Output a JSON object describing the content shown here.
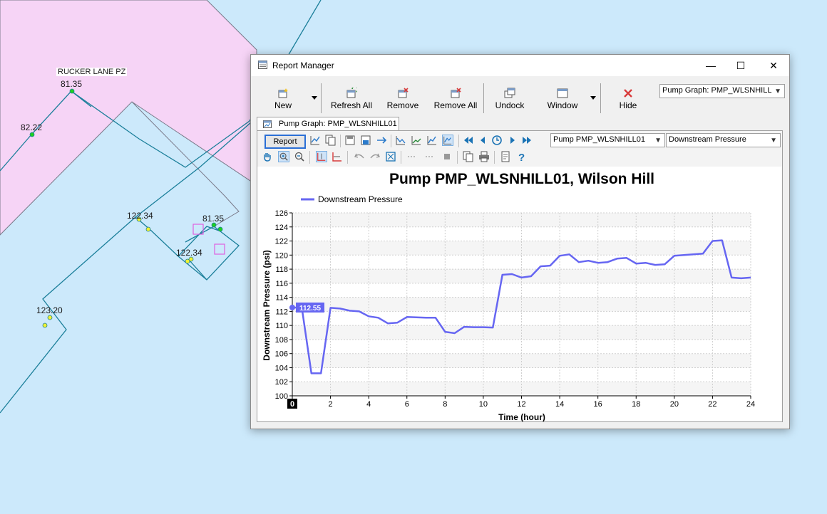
{
  "map": {
    "zone_label": "RUCKER LANE PZ",
    "node_labels": [
      "81.35",
      "82.22",
      "122.34",
      "81.35",
      "122.34",
      "123.20"
    ]
  },
  "window": {
    "title": "Report Manager",
    "controls": {
      "minimize": "—",
      "maximize": "☐",
      "close": "✕"
    }
  },
  "toolbar": {
    "new_label": "New",
    "refresh_all_label": "Refresh All",
    "remove_label": "Remove",
    "remove_all_label": "Remove All",
    "undock_label": "Undock",
    "window_label": "Window",
    "hide_label": "Hide",
    "report_select": "Pump Graph: PMP_WLSNHILL"
  },
  "tab": {
    "label": "Pump Graph: PMP_WLSNHILL01"
  },
  "report_toolbar": {
    "report_button": "Report",
    "element_select": "Pump PMP_WLSNHILL01",
    "attribute_select": "Downstream Pressure"
  },
  "colors": {
    "series": "#6666f2",
    "accent": "#2b6fd6",
    "hide_x": "#d83a3a"
  },
  "chart_data": {
    "type": "line",
    "title": "Pump PMP_WLSNHILL01, Wilson Hill",
    "xlabel": "Time (hour)",
    "ylabel": "Downstream Pressure (psi)",
    "xlim": [
      0,
      24
    ],
    "ylim": [
      100,
      126
    ],
    "x_ticks": [
      0,
      2,
      4,
      6,
      8,
      10,
      12,
      14,
      16,
      18,
      20,
      22,
      24
    ],
    "y_ticks": [
      100,
      102,
      104,
      106,
      108,
      110,
      112,
      114,
      116,
      118,
      120,
      122,
      124,
      126
    ],
    "grid": true,
    "legend": "top-left",
    "cursor": {
      "x": 0,
      "value_label": "112.55"
    },
    "current_time_label": "0",
    "series": [
      {
        "name": "Downstream Pressure",
        "x": [
          0,
          0.5,
          1,
          1.5,
          2,
          2.5,
          3,
          3.5,
          4,
          4.5,
          5,
          5.5,
          6,
          6.5,
          7,
          7.5,
          8,
          8.5,
          9,
          9.5,
          10,
          10.5,
          11,
          11.5,
          12,
          12.5,
          13,
          13.5,
          14,
          14.5,
          15,
          15.5,
          16,
          16.5,
          17,
          17.5,
          18,
          18.5,
          19,
          19.5,
          20,
          20.5,
          21,
          21.5,
          22,
          22.5,
          23,
          23.5,
          24
        ],
        "values": [
          112.55,
          112.5,
          103.2,
          103.2,
          112.5,
          112.4,
          112.1,
          112.0,
          111.3,
          111.1,
          110.3,
          110.4,
          111.2,
          111.15,
          111.1,
          111.1,
          109.1,
          108.9,
          109.8,
          109.75,
          109.75,
          109.7,
          117.2,
          117.3,
          116.8,
          117.0,
          118.4,
          118.5,
          119.9,
          120.1,
          119.0,
          119.2,
          118.9,
          119.0,
          119.5,
          119.6,
          118.8,
          118.9,
          118.6,
          118.7,
          119.9,
          120.0,
          120.1,
          120.2,
          122.0,
          122.1,
          116.8,
          116.7,
          116.8
        ]
      }
    ]
  }
}
